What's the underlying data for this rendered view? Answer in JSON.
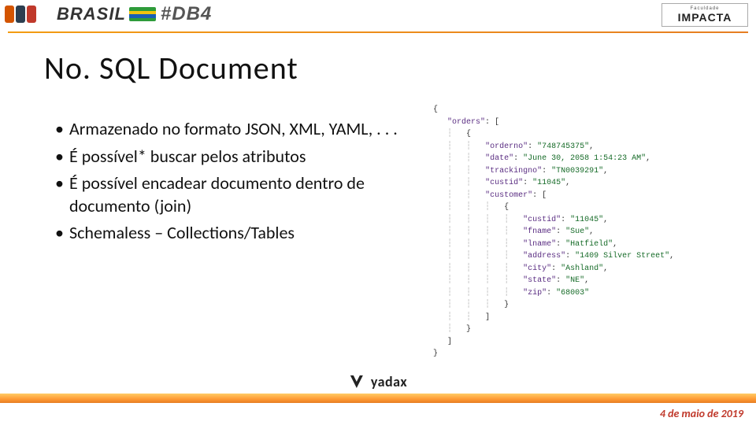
{
  "header": {
    "brand_left_1": "BRASIL",
    "brand_left_2": "#DB4",
    "brand_right_small": "Faculdade",
    "brand_right_big": "IMPACTA"
  },
  "title": "No. SQL Document",
  "bullets": [
    "Armazenado no formato JSON, XML, YAML, . . .",
    "É possível* buscar pelos atributos",
    "É possível encadear documento dentro de documento (join)",
    "Schemaless – Collections/Tables"
  ],
  "code": {
    "orders_key": "\"orders\"",
    "orderno_key": "\"orderno\"",
    "orderno_val": "\"748745375\"",
    "date_key": "\"date\"",
    "date_val": "\"June 30, 2058 1:54:23 AM\"",
    "trackingno_key": "\"trackingno\"",
    "trackingno_val": "\"TN0039291\"",
    "custid_key": "\"custid\"",
    "custid_val": "\"11045\"",
    "customer_key": "\"customer\"",
    "custid2_key": "\"custid\"",
    "custid2_val": "\"11045\"",
    "fname_key": "\"fname\"",
    "fname_val": "\"Sue\"",
    "lname_key": "\"lname\"",
    "lname_val": "\"Hatfield\"",
    "address_key": "\"address\"",
    "address_val": "\"1409 Silver Street\"",
    "city_key": "\"city\"",
    "city_val": "\"Ashland\"",
    "state_key": "\"state\"",
    "state_val": "\"NE\"",
    "zip_key": "\"zip\"",
    "zip_val": "\"68003\""
  },
  "footer": {
    "logo_text": "yadax",
    "date": "4 de maio de 2019"
  }
}
